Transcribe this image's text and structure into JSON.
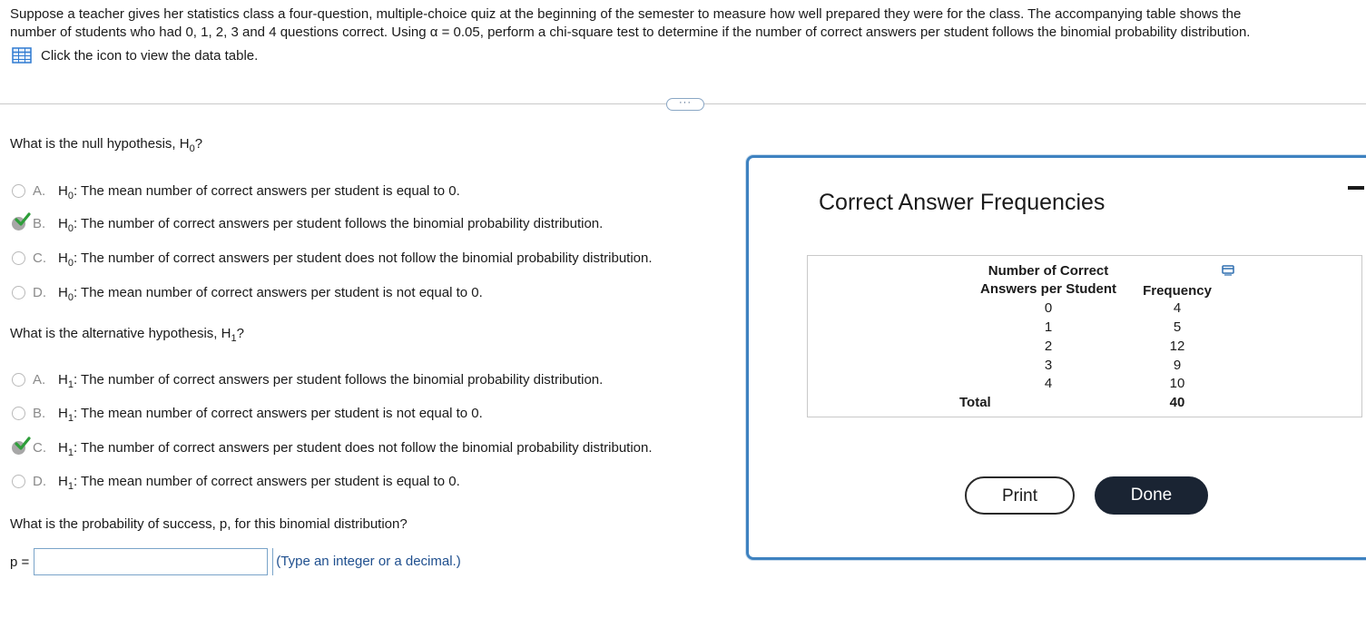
{
  "intro": {
    "line1": "Suppose a teacher gives her statistics class a four-question, multiple-choice quiz at the beginning of the semester to measure how well prepared they were for the class. The accompanying table shows the",
    "line2": "number of students who had 0, 1, 2, 3 and 4 questions correct. Using α = 0.05, perform a chi-square test to determine if the number of correct answers per student follows the binomial probability distribution.",
    "link_text": "Click the icon to view the data table."
  },
  "more_label": "···",
  "q1": {
    "prompt": "What is the null hypothesis, H",
    "prompt_sub": "0",
    "prompt_end": "?",
    "options": [
      {
        "letter": "A.",
        "h": "H",
        "sub": "0",
        "text": ": The mean number of correct answers per student is equal to 0.",
        "selected": false
      },
      {
        "letter": "B.",
        "h": "H",
        "sub": "0",
        "text": ": The number of correct answers per student follows the binomial probability distribution.",
        "selected": true
      },
      {
        "letter": "C.",
        "h": "H",
        "sub": "0",
        "text": ": The number of correct answers per student does not follow the binomial probability distribution.",
        "selected": false
      },
      {
        "letter": "D.",
        "h": "H",
        "sub": "0",
        "text": ": The mean number of correct answers per student is not equal to 0.",
        "selected": false
      }
    ]
  },
  "q2": {
    "prompt": "What is the alternative hypothesis, H",
    "prompt_sub": "1",
    "prompt_end": "?",
    "options": [
      {
        "letter": "A.",
        "h": "H",
        "sub": "1",
        "text": ": The number of correct answers per student follows the binomial probability distribution.",
        "selected": false
      },
      {
        "letter": "B.",
        "h": "H",
        "sub": "1",
        "text": ": The mean number of correct answers per student is not equal to 0.",
        "selected": false
      },
      {
        "letter": "C.",
        "h": "H",
        "sub": "1",
        "text": ": The number of correct answers per student does not follow the binomial probability distribution.",
        "selected": true
      },
      {
        "letter": "D.",
        "h": "H",
        "sub": "1",
        "text": ": The mean number of correct answers per student is equal to 0.",
        "selected": false
      }
    ]
  },
  "q3": {
    "prompt": "What is the probability of success, p, for this binomial distribution?",
    "input_label": "p =",
    "input_value": "",
    "hint": "(Type an integer or a decimal.)"
  },
  "dialog": {
    "title": "Correct Answer Frequencies",
    "col1_header_line1": "Number of Correct",
    "col1_header_line2": "Answers per Student",
    "col2_header": "Frequency",
    "rows": [
      {
        "n": "0",
        "f": "4"
      },
      {
        "n": "1",
        "f": "5"
      },
      {
        "n": "2",
        "f": "12"
      },
      {
        "n": "3",
        "f": "9"
      },
      {
        "n": "4",
        "f": "10"
      }
    ],
    "total_label": "Total",
    "total_value": "40",
    "print_label": "Print",
    "done_label": "Done"
  },
  "colors": {
    "accent": "#3e82c0",
    "check": "#2e9e3a",
    "done_bg": "#1a2433"
  }
}
